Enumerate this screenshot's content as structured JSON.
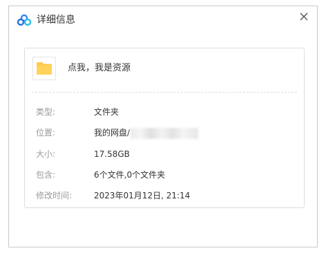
{
  "window": {
    "title": "详细信息",
    "close_glyph": "✕"
  },
  "item": {
    "name": "点我，我是资源",
    "icon": "folder-icon"
  },
  "properties": [
    {
      "label": "类型:",
      "value": "文件夹"
    },
    {
      "label": "位置:",
      "value": "我的网盘/"
    },
    {
      "label": "大小:",
      "value": "17.58GB"
    },
    {
      "label": "包含:",
      "value": "6个文件,0个文件夹"
    },
    {
      "label": "修改时间:",
      "value": "2023年01月12日, 21:14"
    }
  ],
  "colors": {
    "folder": "#ffc94a",
    "app_icon": "#3c80f6",
    "border": "#c9c9c9"
  }
}
